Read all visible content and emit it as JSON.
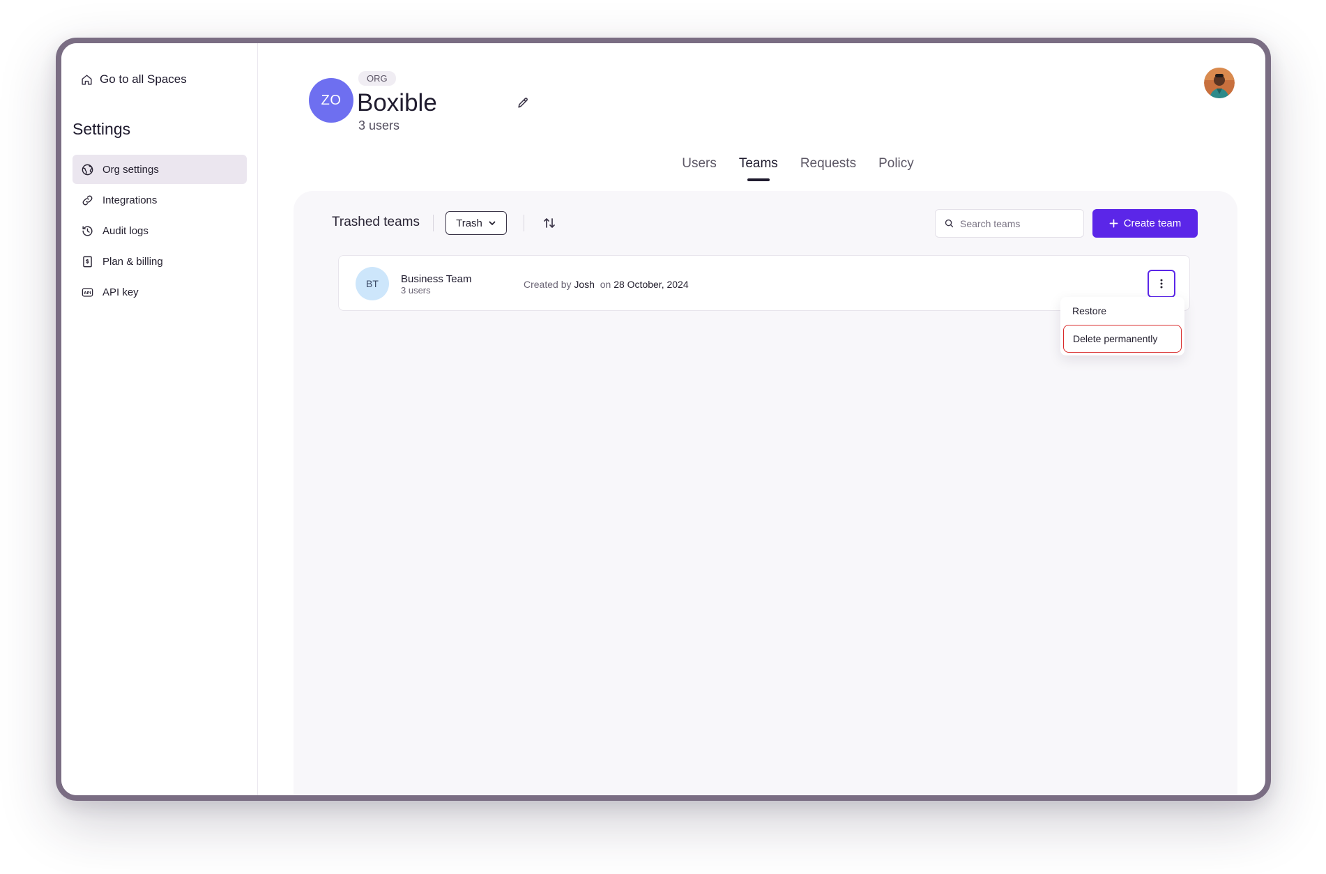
{
  "sidebar": {
    "go_spaces": "Go to all Spaces",
    "settings_title": "Settings",
    "items": [
      {
        "label": "Org settings",
        "icon": "globe-icon"
      },
      {
        "label": "Integrations",
        "icon": "link-icon"
      },
      {
        "label": "Audit logs",
        "icon": "history-icon"
      },
      {
        "label": "Plan & billing",
        "icon": "billing-icon"
      },
      {
        "label": "API key",
        "icon": "api-icon"
      }
    ]
  },
  "org": {
    "initials": "ZO",
    "badge": "ORG",
    "name": "Boxible",
    "users": "3 users"
  },
  "tabs": [
    {
      "label": "Users"
    },
    {
      "label": "Teams"
    },
    {
      "label": "Requests"
    },
    {
      "label": "Policy"
    }
  ],
  "toolbar": {
    "title": "Trashed teams",
    "filter_label": "Trash",
    "search_placeholder": "Search teams",
    "create_label": "Create team"
  },
  "teams": [
    {
      "initials": "BT",
      "name": "Business Team",
      "users": "3 users",
      "created_prefix": "Created by",
      "created_by": "Josh",
      "created_on_prefix": "on",
      "created_date": "28 October, 2024"
    }
  ],
  "menu": {
    "restore": "Restore",
    "delete": "Delete permanently"
  },
  "colors": {
    "accent": "#5b26e8",
    "org_avatar": "#6e6ff0",
    "danger_outline": "#d92a2a",
    "frame": "#7a6d83"
  }
}
